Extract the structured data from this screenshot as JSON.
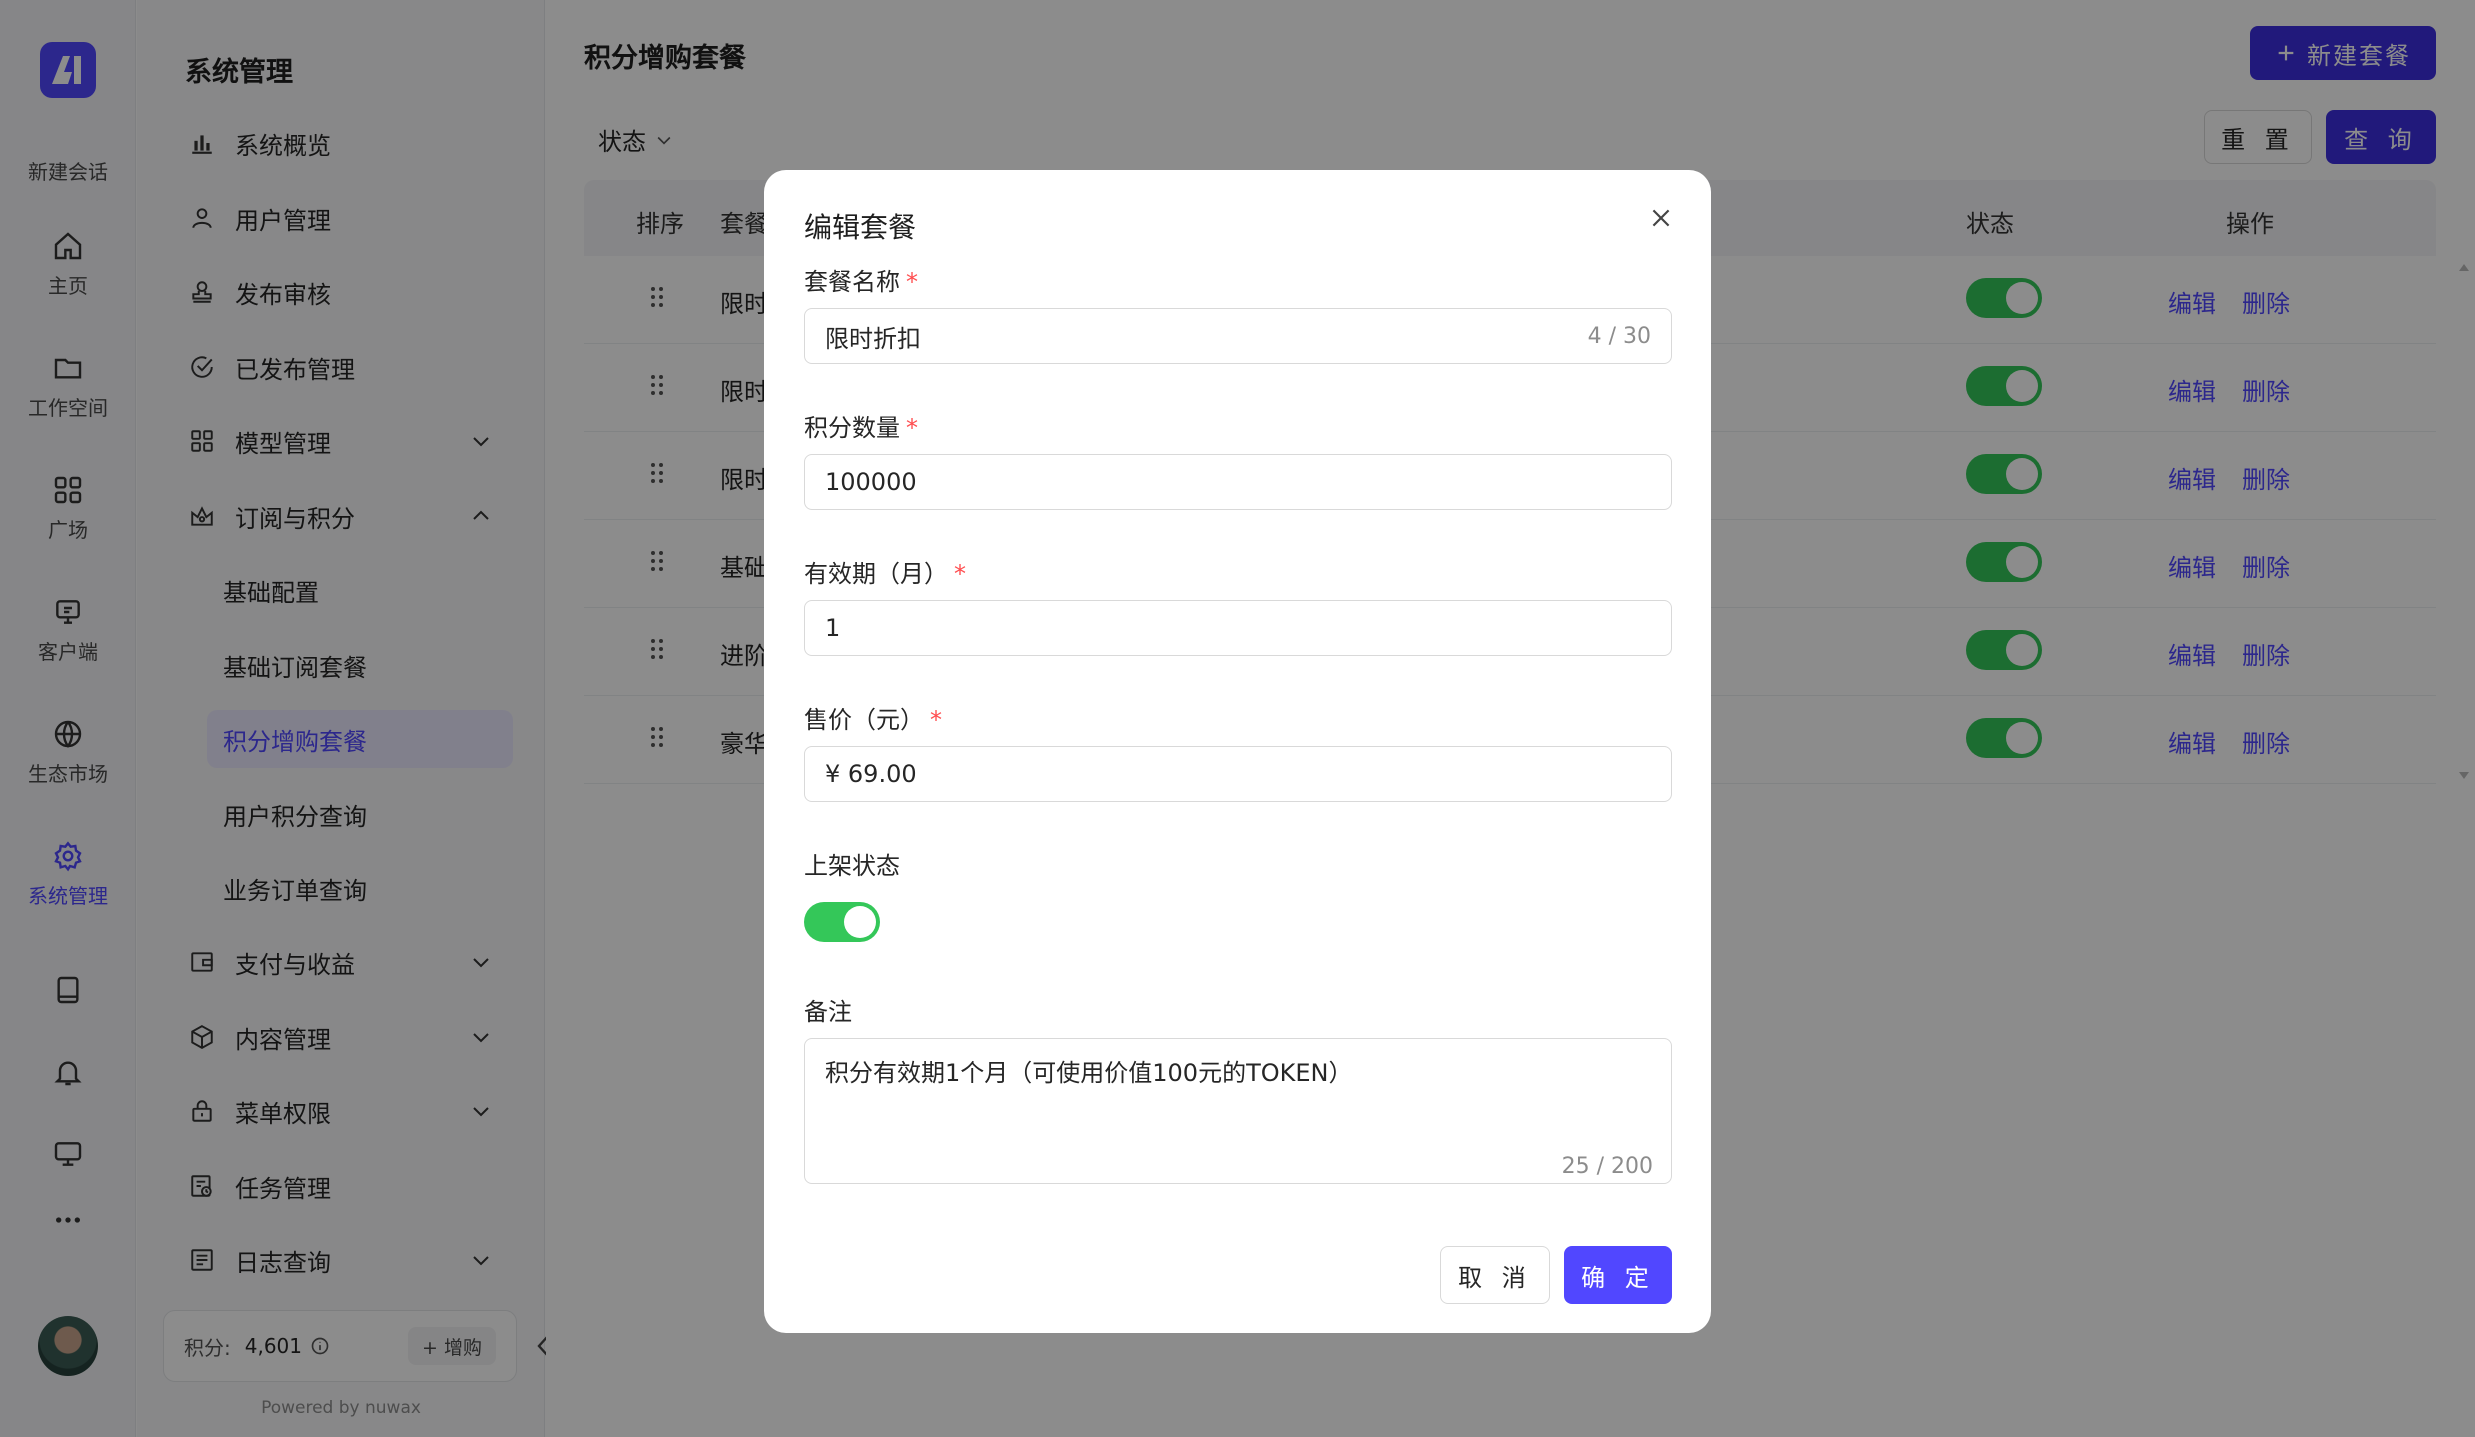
{
  "rail": {
    "new_chat": "新建会话",
    "items": [
      {
        "label": "主页",
        "icon": "home-icon"
      },
      {
        "label": "工作空间",
        "icon": "folder-icon"
      },
      {
        "label": "广场",
        "icon": "grid-icon"
      },
      {
        "label": "客户端",
        "icon": "client-icon"
      },
      {
        "label": "生态市场",
        "icon": "globe-icon"
      },
      {
        "label": "系统管理",
        "icon": "gear-icon",
        "active": true
      }
    ],
    "bottom_icons": [
      "book-icon",
      "bell-icon",
      "monitor-icon",
      "more-icon"
    ]
  },
  "sidebar": {
    "title": "系统管理",
    "items": [
      {
        "label": "系统概览",
        "icon": "bar-chart-icon"
      },
      {
        "label": "用户管理",
        "icon": "user-icon"
      },
      {
        "label": "发布审核",
        "icon": "stamp-icon"
      },
      {
        "label": "已发布管理",
        "icon": "check-circle-icon"
      },
      {
        "label": "模型管理",
        "icon": "apps-icon",
        "expandable": true
      },
      {
        "label": "订阅与积分",
        "icon": "crown-icon",
        "expanded": true
      },
      {
        "label": "支付与收益",
        "icon": "wallet-icon",
        "expandable": true
      },
      {
        "label": "内容管理",
        "icon": "box-icon",
        "expandable": true
      },
      {
        "label": "菜单权限",
        "icon": "lock-icon",
        "expandable": true
      },
      {
        "label": "任务管理",
        "icon": "task-icon"
      },
      {
        "label": "日志查询",
        "icon": "log-icon",
        "expandable": true
      }
    ],
    "sub_items": [
      "基础配置",
      "基础订阅套餐",
      "积分增购套餐",
      "用户积分查询",
      "业务订单查询"
    ],
    "active_sub": "积分增购套餐",
    "points_label": "积分:",
    "points_value": "4,601",
    "buy_label": "+ 增购",
    "powered_by": "Powered by nuwax"
  },
  "main": {
    "title": "积分增购套餐",
    "new_button": "新建套餐",
    "filter_label": "状态",
    "reset_button": "重 置",
    "query_button": "查 询",
    "columns": {
      "sort": "排序",
      "name": "套餐",
      "status": "状态",
      "actions": "操作"
    },
    "rows": [
      {
        "name": "限时",
        "status": true
      },
      {
        "name": "限时",
        "status": true
      },
      {
        "name": "限时",
        "status": true
      },
      {
        "name": "基础",
        "status": true
      },
      {
        "name": "进阶",
        "status": true
      },
      {
        "name": "豪华",
        "status": true
      }
    ],
    "edit_label": "编辑",
    "delete_label": "删除"
  },
  "modal": {
    "title": "编辑套餐",
    "fields": {
      "name_label": "套餐名称",
      "name_value": "限时折扣",
      "name_count": "4 / 30",
      "points_label": "积分数量",
      "points_value": "100000",
      "validity_label": "有效期（月）",
      "validity_value": "1",
      "price_label": "售价（元）",
      "price_value": "¥ 69.00",
      "status_label": "上架状态",
      "status_on": true,
      "remark_label": "备注",
      "remark_value": "积分有效期1个月（可使用价值100元的TOKEN）",
      "remark_count": "25 / 200"
    },
    "cancel_button": "取 消",
    "ok_button": "确 定"
  },
  "colors": {
    "accent": "#5147ff",
    "toggle_on": "#34c759",
    "required": "#ff4d4f"
  }
}
